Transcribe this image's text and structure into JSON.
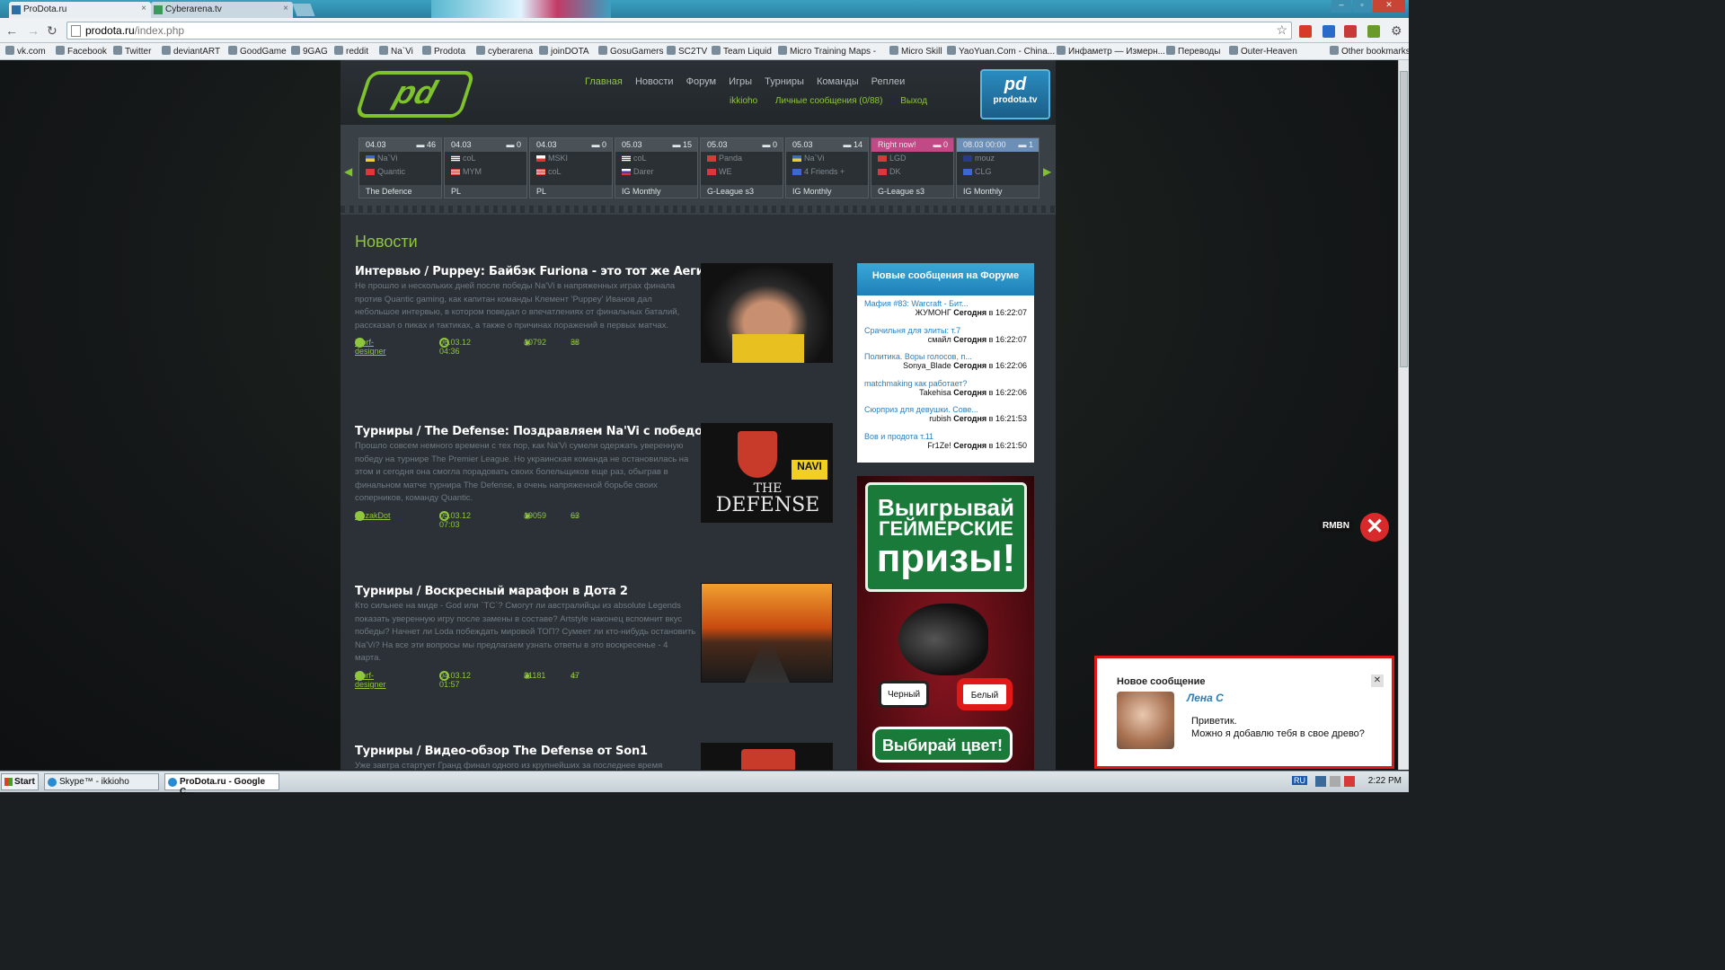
{
  "browser": {
    "tabs": [
      {
        "label": "ProDota.ru",
        "active": true
      },
      {
        "label": "Cyberarena.tv",
        "active": false
      }
    ],
    "url_host": "prodota.ru",
    "url_path": "/index.php",
    "bookmarks": [
      "vk.com",
      "Facebook",
      "Twitter",
      "deviantART",
      "GoodGame",
      "9GAG",
      "reddit",
      "Na`Vi",
      "Prodota",
      "cyberarena",
      "joinDOTA",
      "GosuGamers",
      "SC2TV",
      "Team Liquid",
      "Micro Training Maps -",
      "Micro Skill",
      "YaoYuan.Com - China...",
      "Инфаметр — Измерн...",
      "Переводы",
      "Outer-Heaven"
    ],
    "other_bookmarks": "Other bookmarks"
  },
  "site": {
    "logo_text": "pd",
    "tv_logo": {
      "big": "pd",
      "small": "prodota.tv"
    },
    "nav": [
      "Главная",
      "Новости",
      "Форум",
      "Игры",
      "Турниры",
      "Команды",
      "Реплеи"
    ],
    "subnav": [
      "ikkioho",
      "Личные сообщения (0/88)",
      "Выход"
    ]
  },
  "matches": [
    {
      "date": "04.03",
      "comments": "46",
      "team1": "Na`Vi",
      "team2": "Quantic",
      "event": "The Defence",
      "status": "normal"
    },
    {
      "date": "04.03",
      "comments": "0",
      "team1": "coL",
      "team2": "MYM",
      "event": "PL",
      "status": "normal"
    },
    {
      "date": "04.03",
      "comments": "0",
      "team1": "MSKI",
      "team2": "coL",
      "event": "PL",
      "status": "normal"
    },
    {
      "date": "05.03",
      "comments": "15",
      "team1": "coL",
      "team2": "Darer",
      "event": "IG Monthly",
      "status": "normal"
    },
    {
      "date": "05.03",
      "comments": "0",
      "team1": "Panda",
      "team2": "WE",
      "event": "G-League s3",
      "status": "normal"
    },
    {
      "date": "05.03",
      "comments": "14",
      "team1": "Na`Vi",
      "team2": "4 Friends +",
      "event": "IG Monthly",
      "status": "normal"
    },
    {
      "date": "Right now!",
      "comments": "0",
      "team1": "LGD",
      "team2": "DK",
      "event": "G-League s3",
      "status": "now"
    },
    {
      "date": "08.03 00:00",
      "comments": "1",
      "team1": "mouz",
      "team2": "CLG",
      "event": "IG Monthly",
      "status": "soon"
    }
  ],
  "news_heading": "Новости",
  "articles": [
    {
      "title": "Интервью / Puppey: Байбэк Furiona - это тот же Аегис",
      "text": "Не прошло и нескольких дней после победы Na'Vi в напряженных играх финала против Quantic gaming, как капитан команды Клемент 'Puppey' Иванов дал небольшое интервью, в котором поведал о впечатлениях от финальных баталий, рассказал о пиках и тактиках, а также о причинах поражений в первых матчах.",
      "author": "Morf-designer",
      "date": "06.03.12 04:36",
      "views": "10792",
      "comments": "38"
    },
    {
      "title": "Турниры / The Defense: Поздравляем Na'Vi с победой!",
      "text": "Прошло совсем немного времени с тех пор, как Na'Vi сумели одержать уверенную победу на турнире The Premier League. Но украинская команда не остановилась на этом и сегодня она смогла порадовать своих болельщиков еще раз, обыграв в финальном матче турнира The Defense, в очень напряженной борьбе своих соперников, команду Quantic.",
      "author": "RezakDot",
      "date": "05.03.12 07:03",
      "views": "19059",
      "comments": "63"
    },
    {
      "title": "Турниры / Воскресный марафон в Дота 2",
      "text": "Кто сильнее на миде - God или `TC`? Смогут ли австралийцы из absolute Legends показать уверенную игру после замены в составе? Artstyle наконец вспомнит вкус победы? Начнет ли Loda побеждать мировой ТОП? Сумеет ли кто-нибудь остановить Na'Vi? На все эти вопросы мы предлагаем узнать ответы в это воскресенье - 4 марта.",
      "author": "Morf-designer",
      "date": "04.03.12 01:57",
      "views": "21181",
      "comments": "47"
    },
    {
      "title": "Турниры / Видео-обзор The Defense от Son1",
      "text": "Уже завтра стартует Гранд финал одного из крупнейших за последнее время",
      "author": "",
      "date": "",
      "views": "",
      "comments": ""
    }
  ],
  "thumb2": {
    "line1": "THE",
    "line2": "DEFENSE",
    "brand": "NAVI"
  },
  "forum": {
    "title": "Новые сообщения на Форуме",
    "rows": [
      {
        "topic": "Мафия #83: Warcraft - Бит...",
        "user": "ЖУМОНГ",
        "day": "Сегодня",
        "in": "в",
        "time": "16:22:07"
      },
      {
        "topic": "Срачильня для элиты: т.7",
        "user": "смайл",
        "day": "Сегодня",
        "in": "в",
        "time": "16:22:07"
      },
      {
        "topic": "Политика. Воры голосов, п...",
        "user": "Sonya_Blade",
        "day": "Сегодня",
        "in": "в",
        "time": "16:22:06"
      },
      {
        "topic": "matchmaking как работает?",
        "user": "Takehisa",
        "day": "Сегодня",
        "in": "в",
        "time": "16:22:06"
      },
      {
        "topic": "Сюрприз для девушки. Сове...",
        "user": "rubish",
        "day": "Сегодня",
        "in": "в",
        "time": "16:21:53"
      },
      {
        "topic": "Вов и продота т.11",
        "user": "Fr1Ze!",
        "day": "Сегодня",
        "in": "в",
        "time": "16:21:50"
      }
    ]
  },
  "ad": {
    "l1": "Выигрывай",
    "l2": "ГЕЙМЕРСКИЕ",
    "l3": "призы!",
    "black": "Черный",
    "white": "Белый",
    "cta": "Выбирай цвет!"
  },
  "rmbn": "RMBN",
  "popup": {
    "title": "Новое сообщение",
    "name": "Лена С",
    "line1": "Приветик.",
    "line2": "Можно я добавлю тебя в свое древо?",
    "close": "✕"
  },
  "taskbar": {
    "start": "Start",
    "items": [
      {
        "label": "Skype™ - ikkioho",
        "active": false
      },
      {
        "label": "ProDota.ru - Google C...",
        "active": true
      }
    ],
    "lang": "RU",
    "time": "2:22 PM"
  }
}
